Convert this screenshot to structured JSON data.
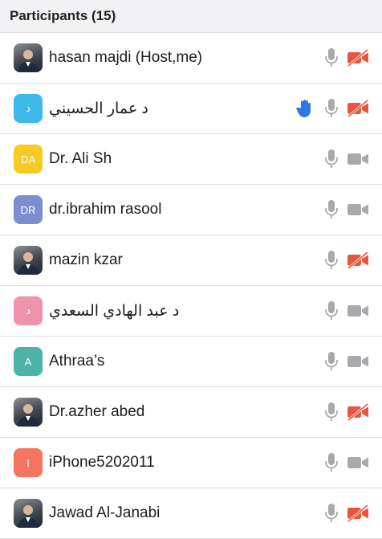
{
  "header": {
    "title": "Participants (15)"
  },
  "participants": [
    {
      "name": "hasan majdi  (Host,me)",
      "avatar_text": "",
      "avatar_color": "#5a6a7a",
      "photo": true,
      "rtl": false,
      "video_off": true,
      "hand": false
    },
    {
      "name": "د عمار الحسيني",
      "avatar_text": "د",
      "avatar_color": "#3fb9ea",
      "photo": false,
      "rtl": true,
      "video_off": true,
      "hand": true
    },
    {
      "name": "Dr. Ali Sh",
      "avatar_text": "DA",
      "avatar_color": "#f6c923",
      "photo": false,
      "rtl": false,
      "video_off": false,
      "hand": false
    },
    {
      "name": "dr.ibrahim rasool",
      "avatar_text": "DR",
      "avatar_color": "#7b8fd0",
      "photo": false,
      "rtl": false,
      "video_off": false,
      "hand": false
    },
    {
      "name": "mazin kzar",
      "avatar_text": "",
      "avatar_color": "#4a5a4a",
      "photo": true,
      "rtl": false,
      "video_off": true,
      "hand": false
    },
    {
      "name": "د  عبد الهادي السعدي",
      "avatar_text": "د",
      "avatar_color": "#ef93ad",
      "photo": false,
      "rtl": true,
      "video_off": false,
      "hand": false
    },
    {
      "name": "Athraa’s",
      "avatar_text": "A",
      "avatar_color": "#4bb3a8",
      "photo": false,
      "rtl": false,
      "video_off": false,
      "hand": false
    },
    {
      "name": "Dr.azher abed",
      "avatar_text": "",
      "avatar_color": "#2b3a55",
      "photo": true,
      "rtl": false,
      "video_off": true,
      "hand": false
    },
    {
      "name": "iPhone5202011",
      "avatar_text": "I",
      "avatar_color": "#f47560",
      "photo": false,
      "rtl": false,
      "video_off": false,
      "hand": false
    },
    {
      "name": "Jawad Al-Janabi",
      "avatar_text": "",
      "avatar_color": "#2a3344",
      "photo": true,
      "rtl": false,
      "video_off": true,
      "hand": false
    }
  ],
  "colors": {
    "icon_gray": "#a9a9ad",
    "video_off_red": "#e8553e",
    "hand_blue": "#2e78e6"
  },
  "icons": {
    "mic": "mic-icon",
    "video": "video-icon",
    "video_off": "video-off-icon",
    "hand": "raised-hand-icon"
  }
}
